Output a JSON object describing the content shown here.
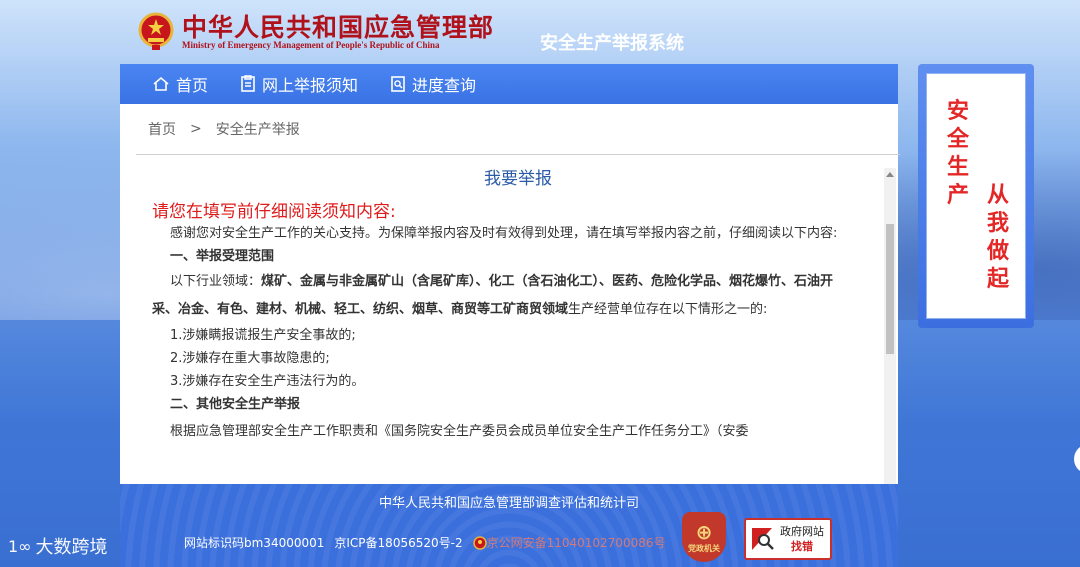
{
  "header": {
    "ministry_cn": "中华人民共和国应急管理部",
    "ministry_en": "Ministry of Emergency Management of People's Republic of China",
    "system_title": "安全生产举报系统"
  },
  "nav": {
    "items": [
      {
        "label": "首页",
        "icon": "home-icon"
      },
      {
        "label": "网上举报须知",
        "icon": "document-icon"
      },
      {
        "label": "进度查询",
        "icon": "search-doc-icon"
      }
    ]
  },
  "breadcrumb": {
    "home": "首页",
    "separator": ">",
    "current": "安全生产举报"
  },
  "content": {
    "title": "我要举报",
    "notice_heading": "请您在填写前仔细阅读须知内容:",
    "intro": "感谢您对安全生产工作的关心支持。为保障举报内容及时有效得到处理，请在填写举报内容之前，仔细阅读以下内容:",
    "section1_title": "一、举报受理范围",
    "section1_lead": "以下行业领域：",
    "section1_industries": "煤矿、金属与非金属矿山（含尾矿库）、化工（含石油化工）、医药、危险化学品、烟花爆竹、石油开采、冶金、有色、建材、机械、轻工、纺织、烟草、商贸等工矿商贸领域",
    "section1_tail": "生产经营单位存在以下情形之一的:",
    "items": [
      "1.涉嫌瞒报谎报生产安全事故的;",
      "2.涉嫌存在重大事故隐患的;",
      "3.涉嫌存在安全生产违法行为的。"
    ],
    "section2_title": "二、其他安全生产举报",
    "section2_text": "根据应急管理部安全生产工作职责和《国务院安全生产委员会成员单位安全生产工作任务分工》（安委"
  },
  "footer": {
    "department": "中华人民共和国应急管理部调查评估和统计司",
    "site_id": "网站标识码bm34000001",
    "icp": "京ICP备18056520号-2",
    "police": "京公网安备11040102700086号",
    "badge_party": "党政机关",
    "badge_gov_line1": "政府网站",
    "badge_gov_line2": "找错"
  },
  "side_banner": {
    "col1": "安全生产",
    "col2": "从我做起"
  },
  "watermark": {
    "logo": "1∞",
    "text": "大数跨境"
  },
  "colors": {
    "brand_red": "#b0121b",
    "nav_blue": "#3a72e4",
    "title_blue": "#2b5ba8",
    "notice_red": "#e01b1b"
  }
}
